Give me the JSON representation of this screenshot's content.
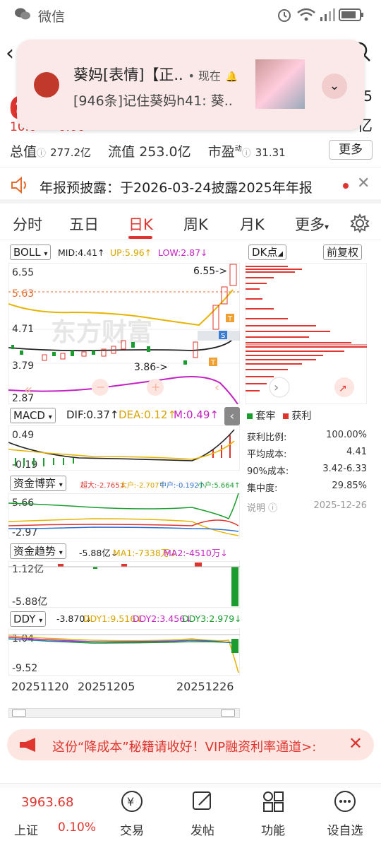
{
  "status_bar": {
    "app_name": "微信"
  },
  "notification": {
    "sender": "葵妈[表情]【正..",
    "meta": "• 现在",
    "message": "[946条]记住葵妈h41: 葵.."
  },
  "quote": {
    "price_partial": "6",
    "sub_partial": "10.0• • 0.00",
    "right_partial_1": "5",
    "right_partial_2": "亿",
    "total_value_label": "总值",
    "total_value": "277.2亿",
    "float_value_label": "流值",
    "float_value": "253.0亿",
    "pe_label": "市盈",
    "pe_sup": "动",
    "pe_value": "31.31",
    "more_button": "更多"
  },
  "report_banner": {
    "text": "年报预披露：于2026-03-24披露2025年年报"
  },
  "tabs": [
    {
      "label": "分时"
    },
    {
      "label": "五日"
    },
    {
      "label": "日K"
    },
    {
      "label": "周K"
    },
    {
      "label": "月K"
    },
    {
      "label": "更多"
    }
  ],
  "kline": {
    "indicator": "BOLL",
    "mid": "MID:4.41↑",
    "up": "UP:5.96↑",
    "low": "LOW:2.87↓",
    "y_labels": [
      "6.55",
      "5.63",
      "4.71",
      "3.79",
      "2.87"
    ],
    "high_marker": "6.55->",
    "low_marker": "3.86->",
    "watermark": "东方财富"
  },
  "dk_panel": {
    "dk_button": "DK点",
    "fq_button": "前复权",
    "legend_locked": "套牢",
    "legend_profit": "获利",
    "rows": [
      {
        "label": "获利比例:",
        "value": "100.00%"
      },
      {
        "label": "平均成本:",
        "value": "4.41"
      },
      {
        "label": "90%成本:",
        "value": "3.42-6.33"
      },
      {
        "label": "集中度:",
        "value": "29.85%"
      }
    ],
    "note_label": "说明",
    "note_date": "2025-12-26"
  },
  "macd": {
    "name": "MACD",
    "dif": "DIF:0.37↑",
    "dea": "DEA:0.12↑",
    "m": "M:0.49↑",
    "y_top": "0.49",
    "y_bottom": "-0.19"
  },
  "fund_game": {
    "name": "资金博弈",
    "super": "超大:-2.765↓",
    "big": "大户:-2.707↑",
    "mid": "中户:-0.192↑",
    "small": "小户:5.664↑",
    "y_top": "5.66",
    "y_bottom": "-2.97"
  },
  "fund_trend": {
    "name": "资金趋势",
    "value": "-5.88亿↓",
    "ma1": "MA1:-7338万↓",
    "ma2": "MA2:-4510万↓",
    "y_top": "1.12亿",
    "y_bottom": "-5.88亿"
  },
  "ddy": {
    "name": "DDY",
    "value": "-3.870↓",
    "ddy1": "DDY1:9.516↓",
    "ddy2": "DDY2:3.456↓",
    "ddy3": "DDY3:2.979↓",
    "y_top": "1.04",
    "y_bottom": "-9.52"
  },
  "dates": [
    "20251120",
    "20251205",
    "20251226"
  ],
  "promo": {
    "text": "这份“降成本”秘籍请收好！VIP融资利率通道>:"
  },
  "bottom_nav": {
    "index_value": "3963.68",
    "index_name": "上证",
    "index_change": "0.10%",
    "items": [
      {
        "label": "交易"
      },
      {
        "label": "发帖"
      },
      {
        "label": "功能"
      },
      {
        "label": "设自选"
      }
    ],
    "hidden_tabs": [
      "...",
      "..."
    ]
  },
  "colors": {
    "red": "#e0342e",
    "green": "#1a9c2e",
    "yellow": "#e6b400",
    "magenta": "#c423c4",
    "blue": "#2d6fd1"
  }
}
